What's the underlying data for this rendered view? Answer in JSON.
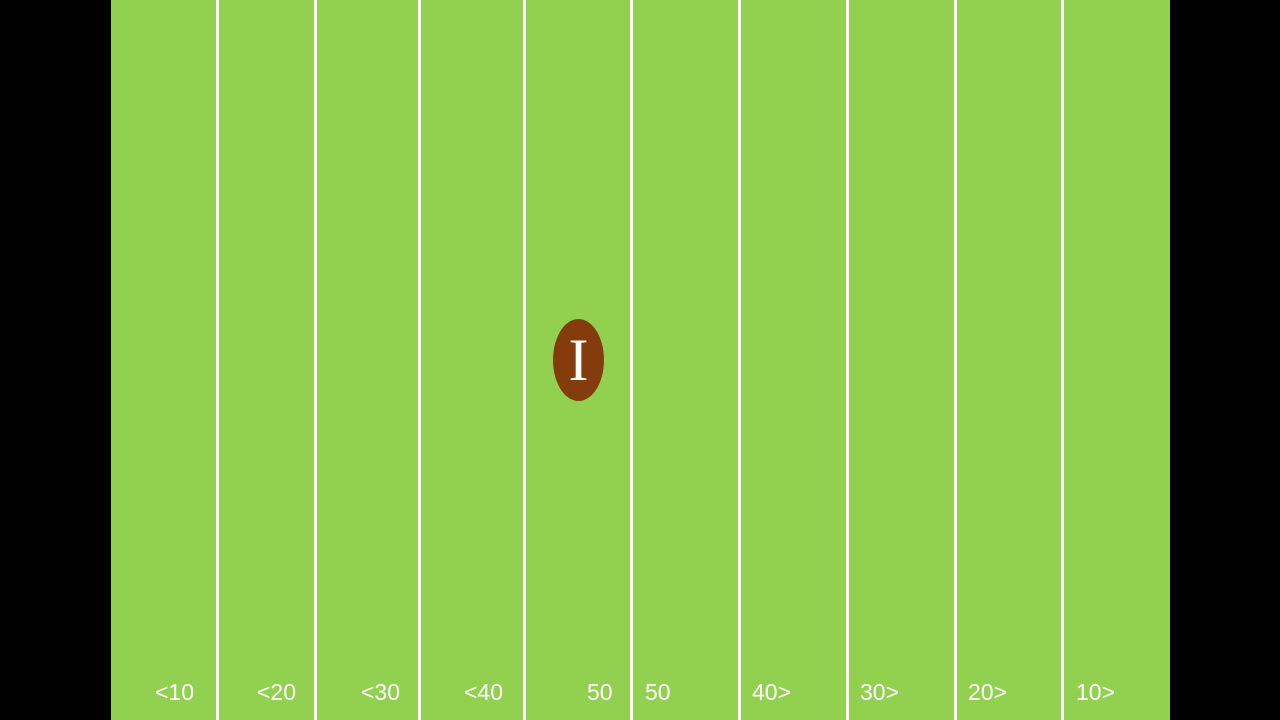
{
  "colors": {
    "background": "#000000",
    "field": "#92d050",
    "lines": "#ffffff",
    "ball": "#843c0c"
  },
  "field": {
    "yard_labels": [
      "<10",
      "<20",
      "<30",
      "<40",
      "50",
      "50",
      "40>",
      "30>",
      "20>",
      "10>"
    ]
  },
  "ball": {
    "icon": "football-icon",
    "laces_text": "I"
  }
}
